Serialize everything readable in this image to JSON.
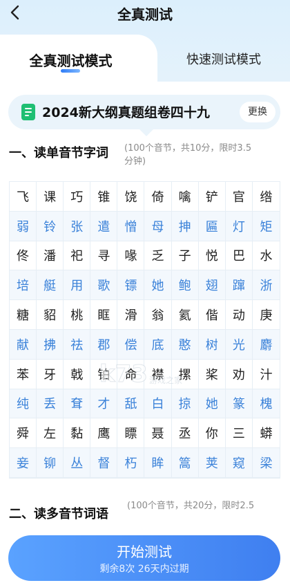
{
  "header": {
    "title": "全真测试"
  },
  "tabs": [
    {
      "label": "全真测试模式"
    },
    {
      "label": "快速测试模式"
    }
  ],
  "paper": {
    "title": "2024新大纲真题组卷四十九",
    "swap_label": "更换"
  },
  "section1": {
    "heading": "一、读单音节字词",
    "note_line1": "(100个音节，共10分，限时3.5",
    "note_line2": "分钟)",
    "characters": [
      [
        "飞",
        "课",
        "巧",
        "锥",
        "饶",
        "倚",
        "噙",
        "铲",
        "官",
        "绺"
      ],
      [
        "弱",
        "铃",
        "张",
        "遣",
        "憎",
        "母",
        "抻",
        "匾",
        "灯",
        "矩"
      ],
      [
        "佟",
        "潘",
        "祀",
        "寻",
        "喙",
        "乏",
        "子",
        "悦",
        "巴",
        "水"
      ],
      [
        "培",
        "艇",
        "用",
        "歌",
        "镖",
        "她",
        "鲍",
        "翅",
        "蹿",
        "浙"
      ],
      [
        "糖",
        "貂",
        "桃",
        "眶",
        "滑",
        "翁",
        "氦",
        "偕",
        "动",
        "庚"
      ],
      [
        "献",
        "拂",
        "祛",
        "郡",
        "偿",
        "底",
        "憨",
        "树",
        "光",
        "麝"
      ],
      [
        "苯",
        "牙",
        "戟",
        "铂",
        "命",
        "襟",
        "摞",
        "桨",
        "劝",
        "汁"
      ],
      [
        "纯",
        "丢",
        "耷",
        "才",
        "舐",
        "白",
        "掠",
        "她",
        "篆",
        "槐"
      ],
      [
        "舜",
        "左",
        "黏",
        "鹰",
        "瞟",
        "聂",
        "丞",
        "你",
        "三",
        "蟒"
      ],
      [
        "妾",
        "铆",
        "丛",
        "督",
        "朽",
        "眸",
        "篙",
        "荚",
        "窥",
        "梁"
      ]
    ]
  },
  "section2": {
    "heading": "二、读多音节词语",
    "note_line1": "(100个音节，共20分，限时2.5"
  },
  "watermark": {
    "text": "k73",
    "sub": "游戏之家"
  },
  "start": {
    "label": "开始测试",
    "sub": "剩余8次 26天内过期"
  }
}
